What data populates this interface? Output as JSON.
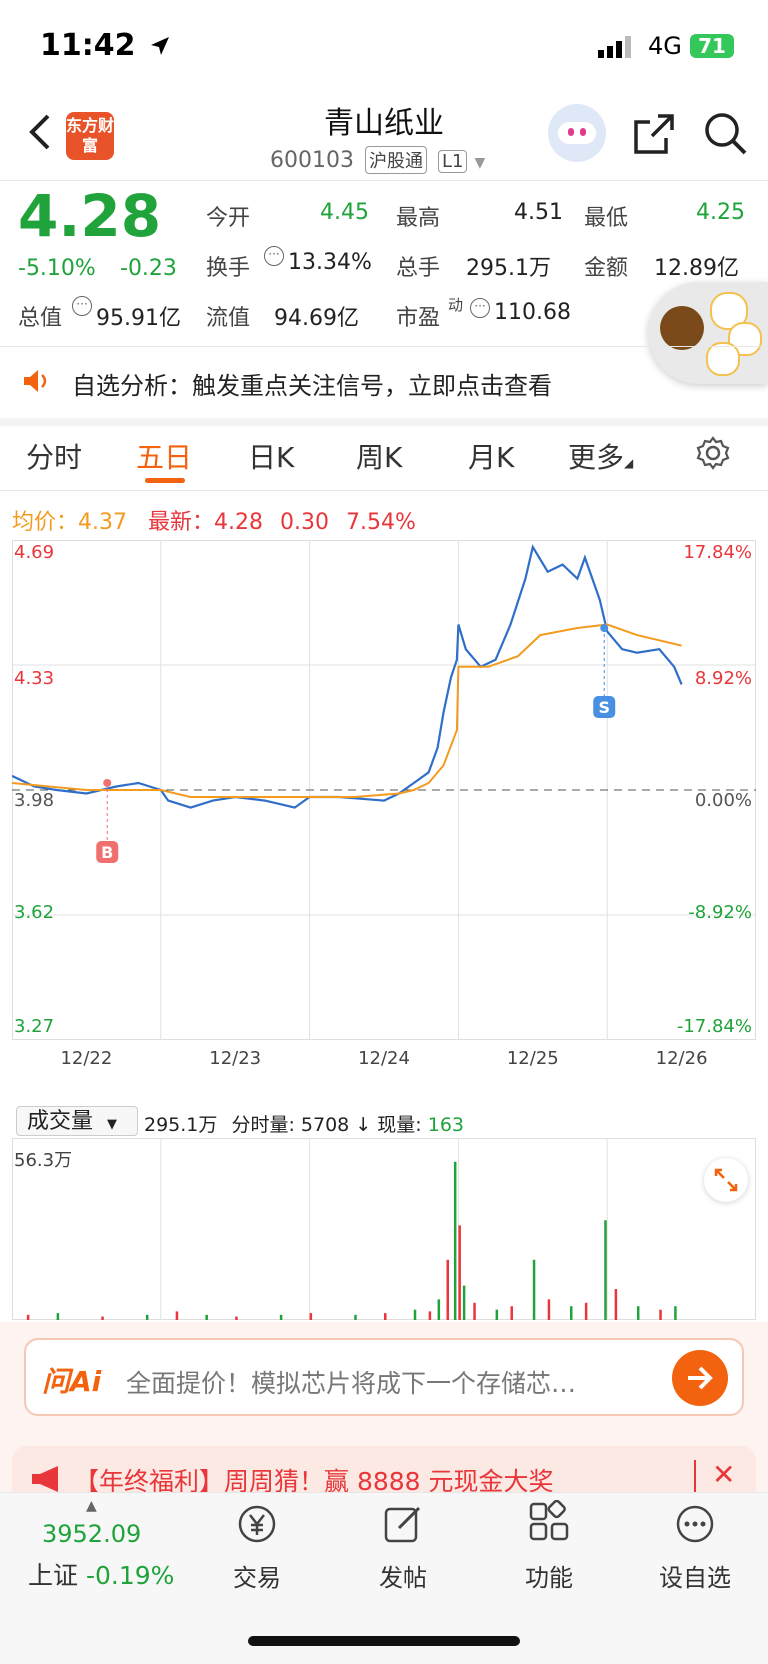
{
  "status": {
    "time": "11:42",
    "network": "4G",
    "battery": "71"
  },
  "header": {
    "title": "青山纸业",
    "code": "600103",
    "tag_connect": "沪股通",
    "tag_level": "L1",
    "logo": "东方财富"
  },
  "quote": {
    "price": "4.28",
    "change_pct": "-5.10%",
    "change": "-0.23",
    "open_label": "今开",
    "open": "4.45",
    "high_label": "最高",
    "high": "4.51",
    "low_label": "最低",
    "low": "4.25",
    "turnover_label": "换手",
    "turnover": "13.34%",
    "volume_label": "总手",
    "volume": "295.1万",
    "amount_label": "金额",
    "amount": "12.89亿",
    "mktcap_label": "总值",
    "mktcap": "95.91亿",
    "float_label": "流值",
    "float": "94.69亿",
    "pe_label": "市盈",
    "pe_sup": "动",
    "pe": "110.68"
  },
  "notice": {
    "text": "自选分析：触发重点关注信号，立即点击查看"
  },
  "tabs": [
    "分时",
    "五日",
    "日K",
    "周K",
    "月K",
    "更多"
  ],
  "active_tab": "五日",
  "info_line": {
    "avg_label": "均价：",
    "avg": "4.37",
    "latest_label": "最新：",
    "latest": "4.28",
    "change": "0.30",
    "pct": "7.54%"
  },
  "chart_data": {
    "type": "line",
    "title": "",
    "x_categories": [
      "12/22",
      "12/23",
      "12/24",
      "12/25",
      "12/26"
    ],
    "y_left_ticks": [
      "4.69",
      "4.33",
      "3.98",
      "3.62",
      "3.27"
    ],
    "y_right_ticks": [
      "17.84%",
      "8.92%",
      "0.00%",
      "-8.92%",
      "-17.84%"
    ],
    "ylim": [
      3.27,
      4.69
    ],
    "reference": 3.98,
    "markers": [
      {
        "label": "B",
        "day": 0.64,
        "price": 4.0
      },
      {
        "label": "S",
        "day": 3.98,
        "price": 4.44
      }
    ],
    "series": [
      {
        "name": "price",
        "color": "#2f6fc9",
        "points": [
          [
            0,
            4.02
          ],
          [
            0.15,
            3.99
          ],
          [
            0.3,
            3.98
          ],
          [
            0.5,
            3.97
          ],
          [
            0.7,
            3.99
          ],
          [
            0.85,
            4.0
          ],
          [
            1.0,
            3.98
          ],
          [
            1.05,
            3.95
          ],
          [
            1.2,
            3.93
          ],
          [
            1.35,
            3.95
          ],
          [
            1.5,
            3.96
          ],
          [
            1.7,
            3.95
          ],
          [
            1.9,
            3.93
          ],
          [
            2.0,
            3.96
          ],
          [
            2.2,
            3.96
          ],
          [
            2.5,
            3.95
          ],
          [
            2.6,
            3.97
          ],
          [
            2.7,
            4.0
          ],
          [
            2.8,
            4.03
          ],
          [
            2.86,
            4.1
          ],
          [
            2.9,
            4.2
          ],
          [
            2.95,
            4.3
          ],
          [
            2.99,
            4.35
          ],
          [
            3.0,
            4.45
          ],
          [
            3.05,
            4.38
          ],
          [
            3.15,
            4.33
          ],
          [
            3.25,
            4.35
          ],
          [
            3.35,
            4.45
          ],
          [
            3.45,
            4.58
          ],
          [
            3.5,
            4.67
          ],
          [
            3.6,
            4.6
          ],
          [
            3.7,
            4.62
          ],
          [
            3.8,
            4.58
          ],
          [
            3.85,
            4.64
          ],
          [
            3.95,
            4.52
          ],
          [
            4.0,
            4.43
          ],
          [
            4.1,
            4.38
          ],
          [
            4.2,
            4.37
          ],
          [
            4.35,
            4.38
          ],
          [
            4.45,
            4.33
          ],
          [
            4.5,
            4.28
          ]
        ]
      },
      {
        "name": "avg",
        "color": "#f29b1f",
        "points": [
          [
            0,
            4.0
          ],
          [
            0.5,
            3.98
          ],
          [
            1.0,
            3.98
          ],
          [
            1.2,
            3.96
          ],
          [
            1.6,
            3.96
          ],
          [
            2.0,
            3.96
          ],
          [
            2.3,
            3.96
          ],
          [
            2.6,
            3.97
          ],
          [
            2.7,
            3.98
          ],
          [
            2.8,
            4.0
          ],
          [
            2.9,
            4.05
          ],
          [
            2.99,
            4.15
          ],
          [
            3.0,
            4.33
          ],
          [
            3.2,
            4.33
          ],
          [
            3.4,
            4.36
          ],
          [
            3.55,
            4.42
          ],
          [
            3.8,
            4.44
          ],
          [
            4.0,
            4.45
          ],
          [
            4.2,
            4.42
          ],
          [
            4.5,
            4.39
          ]
        ]
      }
    ],
    "volume": {
      "label": "成交量",
      "total": "295.1万",
      "tick_label": "分时量:",
      "tick": "5708",
      "now_label": "现量:",
      "now": "163",
      "ymax_label": "56.3万",
      "bars": [
        [
          0.1,
          3
        ],
        [
          0.3,
          4
        ],
        [
          0.6,
          2
        ],
        [
          0.9,
          3
        ],
        [
          1.1,
          5
        ],
        [
          1.3,
          3
        ],
        [
          1.5,
          2
        ],
        [
          1.8,
          3
        ],
        [
          2.0,
          4
        ],
        [
          2.3,
          3
        ],
        [
          2.5,
          4
        ],
        [
          2.7,
          6
        ],
        [
          2.8,
          5
        ],
        [
          2.86,
          12
        ],
        [
          2.92,
          35
        ],
        [
          2.97,
          92
        ],
        [
          3.0,
          55
        ],
        [
          3.03,
          20
        ],
        [
          3.1,
          10
        ],
        [
          3.25,
          6
        ],
        [
          3.35,
          8
        ],
        [
          3.5,
          35
        ],
        [
          3.6,
          12
        ],
        [
          3.75,
          8
        ],
        [
          3.85,
          10
        ],
        [
          3.98,
          58
        ],
        [
          4.05,
          18
        ],
        [
          4.2,
          8
        ],
        [
          4.35,
          6
        ],
        [
          4.45,
          8
        ]
      ]
    }
  },
  "ai_bar": {
    "logo": "问Ai",
    "placeholder": "全面提价！模拟芯片将成下一个存储芯…"
  },
  "promo": {
    "text": "【年终福利】周周猜！赢 8888 元现金大奖"
  },
  "bottom_nav": {
    "index_value": "3952.09",
    "index_name": "上证",
    "index_change": "-0.19%",
    "items": [
      {
        "label": "交易",
        "icon": "yen-cycle-icon"
      },
      {
        "label": "发帖",
        "icon": "edit-icon"
      },
      {
        "label": "功能",
        "icon": "grid-icon"
      },
      {
        "label": "设自选",
        "icon": "more-icon"
      }
    ]
  }
}
